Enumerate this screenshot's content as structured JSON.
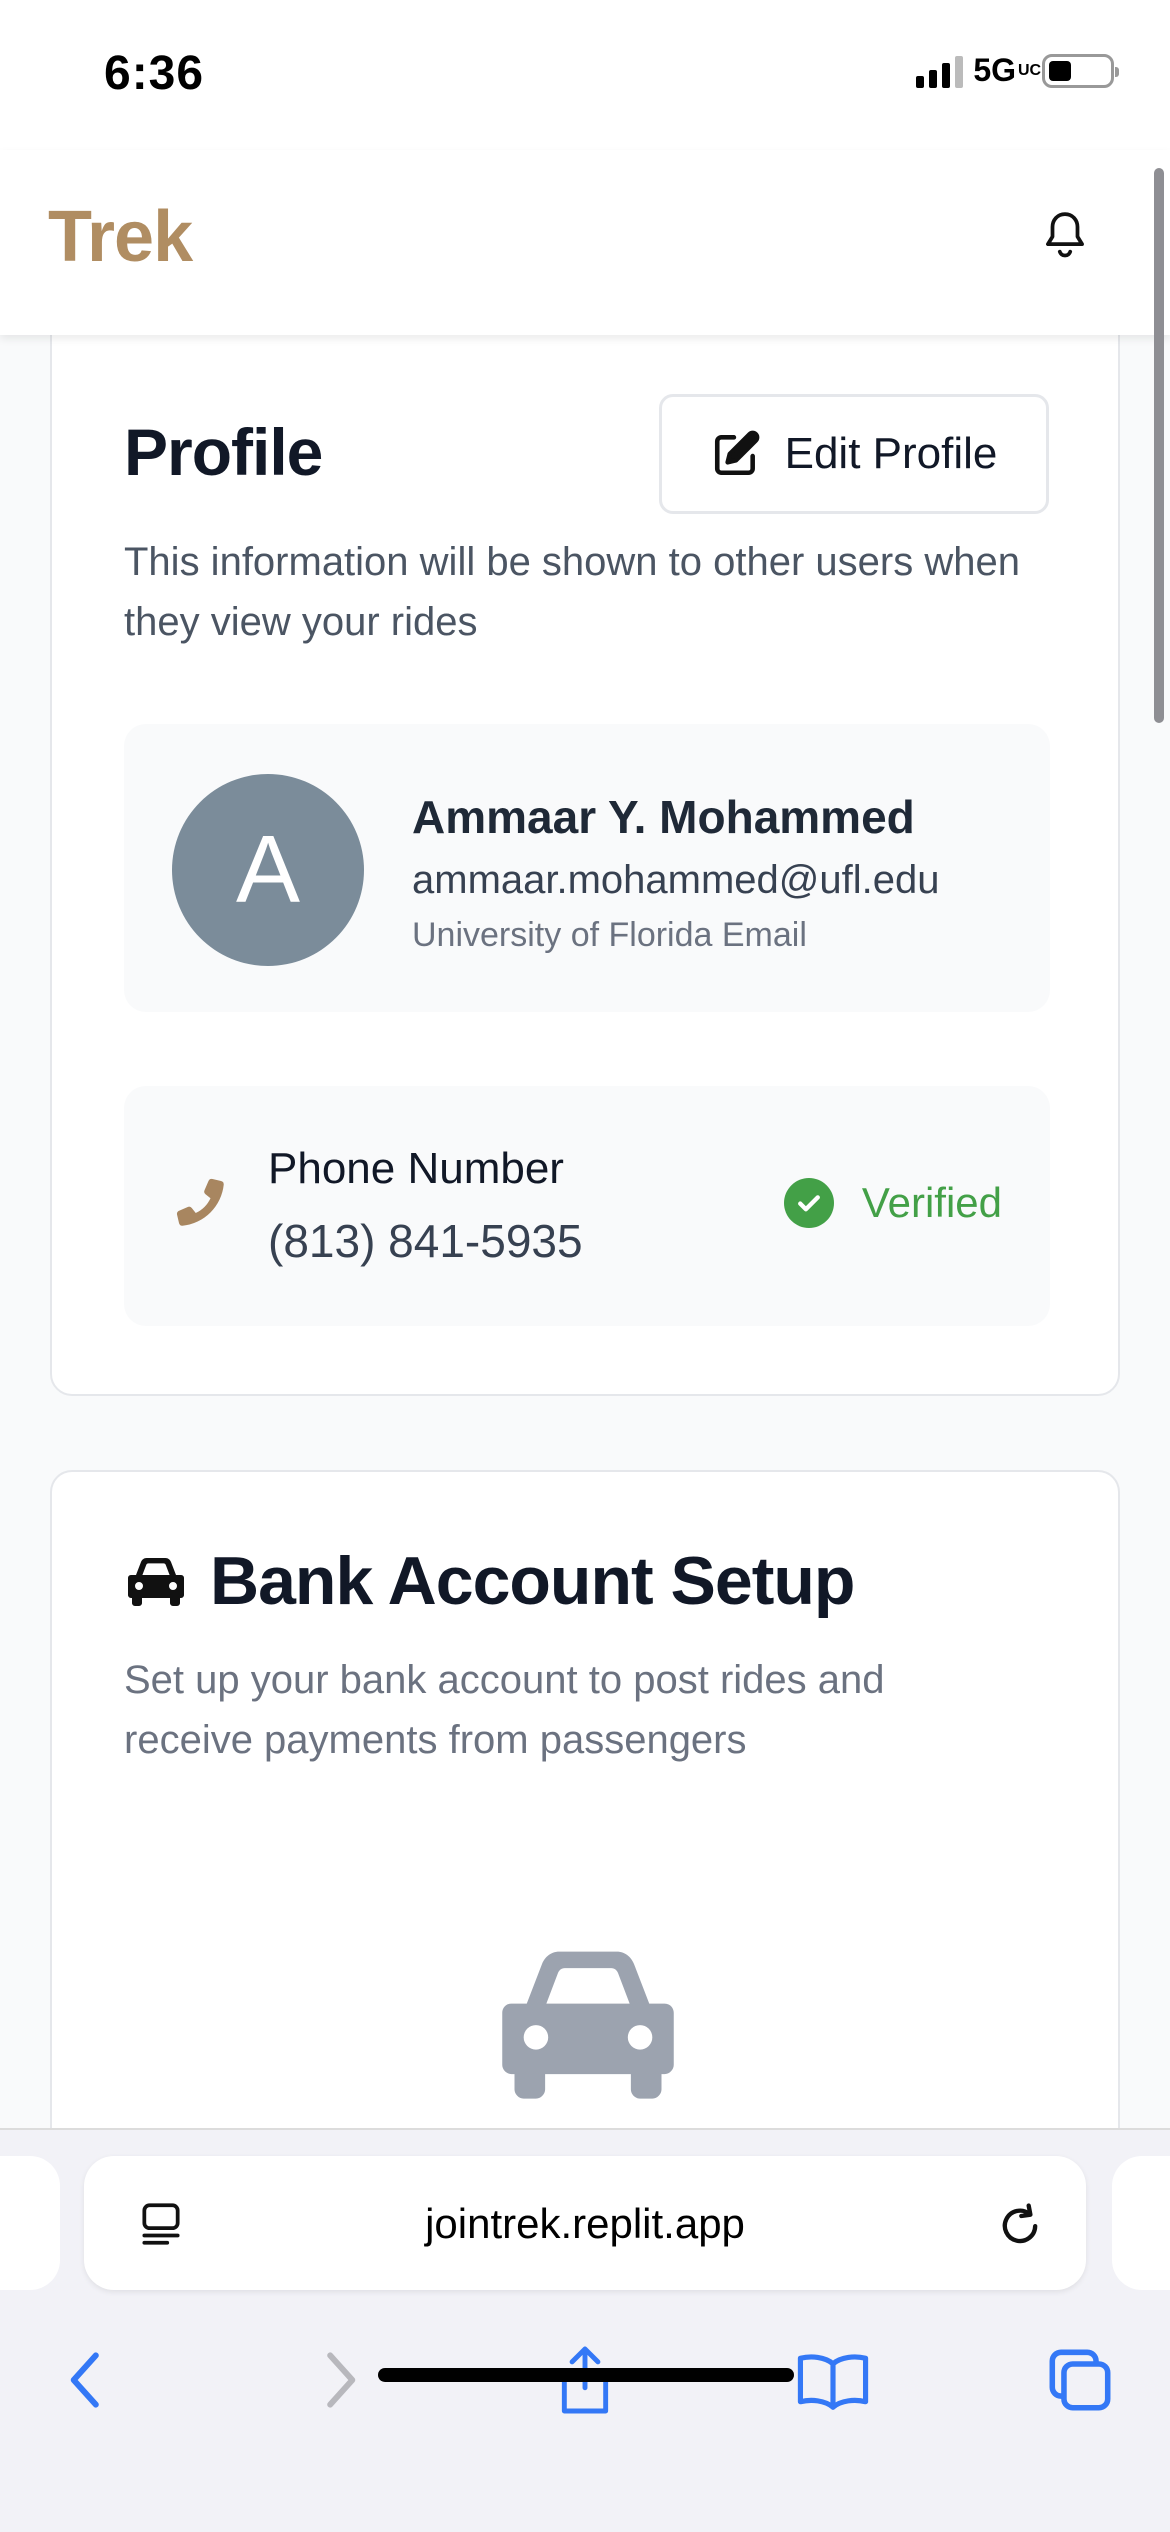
{
  "status_bar": {
    "time": "6:36",
    "network": "5G",
    "network_suffix": "UC"
  },
  "header": {
    "brand": "Trek",
    "brand_color": "#b08d62",
    "notification_icon": "bell-icon"
  },
  "profile": {
    "title": "Profile",
    "edit_button_label": "Edit Profile",
    "edit_icon": "edit-icon",
    "description": "This information will be shown to other users when they view your rides",
    "avatar_initial": "A",
    "name": "Ammaar Y. Mohammed",
    "email": "ammaar.mohammed@ufl.edu",
    "email_label": "University of Florida Email",
    "phone_label": "Phone Number",
    "phone_value": "(813) 841-5935",
    "phone_icon": "phone-icon",
    "verified_label": "Verified",
    "verified_color": "#43a047"
  },
  "bank": {
    "title": "Bank Account Setup",
    "title_icon": "car-icon",
    "description": "Set up your bank account to post rides and receive payments from passengers",
    "illustration_icon": "car-icon"
  },
  "browser": {
    "url": "jointrek.replit.app",
    "left_icon": "page-menu-icon",
    "reload_icon": "reload-icon",
    "nav": {
      "back_icon": "chevron-left-icon",
      "forward_icon": "chevron-right-icon",
      "share_icon": "share-icon",
      "bookmarks_icon": "book-icon",
      "tabs_icon": "tabs-icon"
    }
  }
}
